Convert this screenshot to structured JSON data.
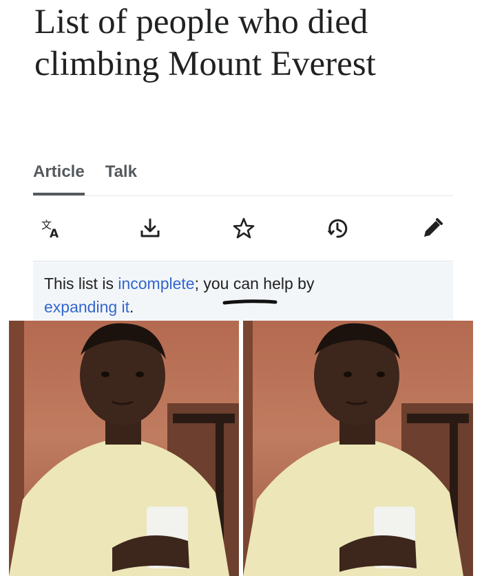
{
  "article": {
    "title": "List of people who died climbing Mount Everest"
  },
  "tabs": [
    {
      "label": "Article",
      "active": true
    },
    {
      "label": "Talk",
      "active": false
    }
  ],
  "toolbar": {
    "icons": [
      "language-icon",
      "download-icon",
      "star-icon",
      "history-icon",
      "edit-pencil-icon"
    ]
  },
  "notice": {
    "text_before": "This list is ",
    "link_incomplete": "incomplete",
    "text_middle": "; you can help by",
    "link_expanding": "expanding it",
    "text_after": "."
  },
  "meme": {
    "panel_count": 2
  },
  "colors": {
    "link": "#3366cc",
    "text": "#202122",
    "tab": "#54595d",
    "notice_bg": "#f3f6f9"
  }
}
